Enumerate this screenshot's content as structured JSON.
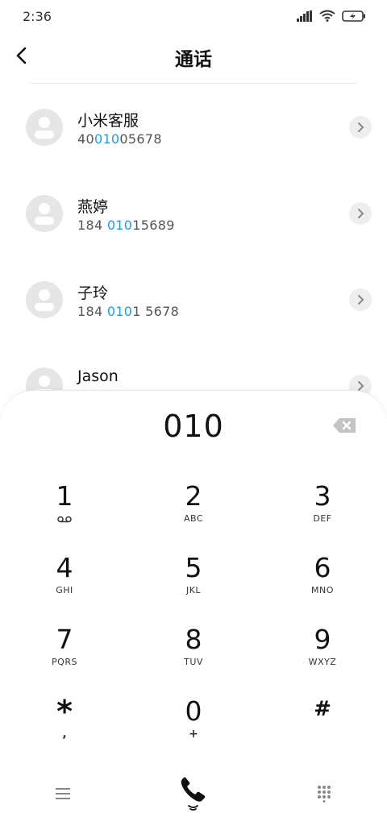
{
  "status_bar": {
    "time": "2:36"
  },
  "header": {
    "title": "通话"
  },
  "contacts": [
    {
      "name": "小米客服",
      "number_pre": "40",
      "number_hl": "010",
      "number_post": "05678"
    },
    {
      "name": "燕婷",
      "number_pre": "184 ",
      "number_hl": "010",
      "number_post": "15689"
    },
    {
      "name": "子玲",
      "number_pre": "184 ",
      "number_hl": "010",
      "number_post": "1 5678"
    },
    {
      "name": "Jason",
      "number_pre": "",
      "number_hl": "",
      "number_post": ""
    }
  ],
  "dialer": {
    "input": "010",
    "keys": [
      {
        "digit": "1",
        "sub": "voicemail-icon"
      },
      {
        "digit": "2",
        "sub": "ABC"
      },
      {
        "digit": "3",
        "sub": "DEF"
      },
      {
        "digit": "4",
        "sub": "GHI"
      },
      {
        "digit": "5",
        "sub": "JKL"
      },
      {
        "digit": "6",
        "sub": "MNO"
      },
      {
        "digit": "7",
        "sub": "PQRS"
      },
      {
        "digit": "8",
        "sub": "TUV"
      },
      {
        "digit": "9",
        "sub": "WXYZ"
      },
      {
        "digit": "*",
        "sub": ","
      },
      {
        "digit": "0",
        "sub": "+"
      },
      {
        "digit": "#",
        "sub": ""
      }
    ]
  },
  "colors": {
    "highlight": "#1a9ee0",
    "avatar_bg": "#e6e6e6"
  },
  "icons": {
    "back": "chevron-left-icon",
    "backspace": "backspace-icon",
    "menu": "menu-icon",
    "call": "phone-icon",
    "keypad": "keypad-icon"
  }
}
